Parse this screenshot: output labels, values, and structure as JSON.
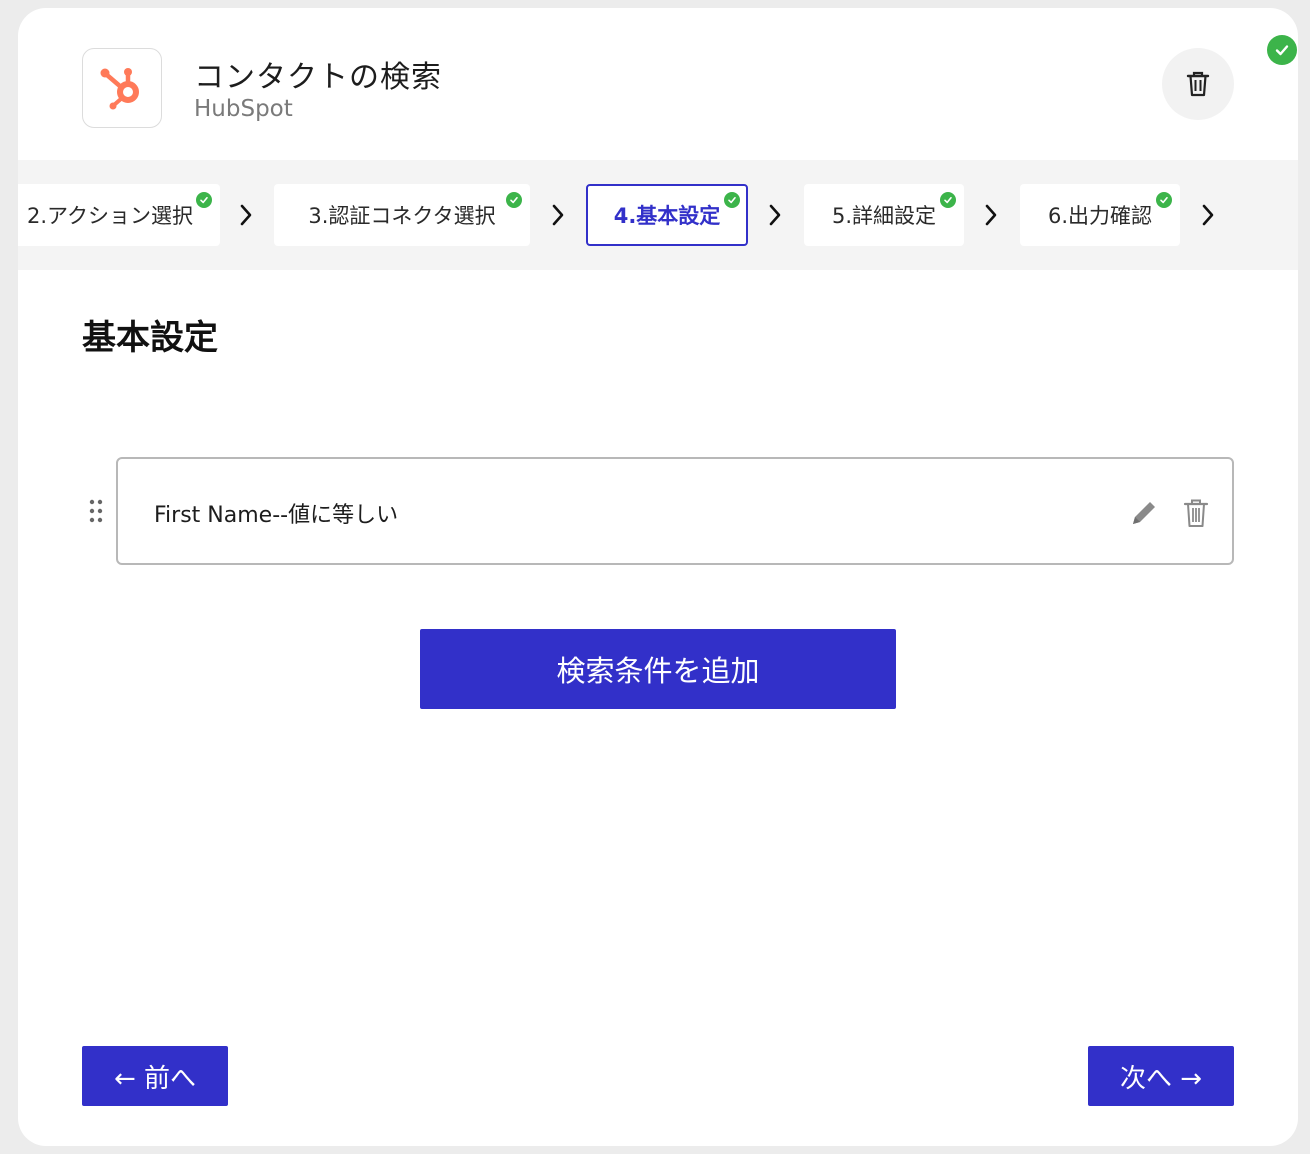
{
  "header": {
    "title": "コンタクトの検索",
    "app_name": "HubSpot",
    "logo_icon": "hubspot-sprocket-icon",
    "trash_icon": "trash-icon",
    "complete_icon": "check-circle-icon"
  },
  "steps": [
    {
      "label": "2.アクション選択",
      "completed": true,
      "active": false
    },
    {
      "label": "3.認証コネクタ選択",
      "completed": true,
      "active": false
    },
    {
      "label": "4.基本設定",
      "completed": true,
      "active": true
    },
    {
      "label": "5.詳細設定",
      "completed": true,
      "active": false
    },
    {
      "label": "6.出力確認",
      "completed": true,
      "active": false
    }
  ],
  "section": {
    "title": "基本設定"
  },
  "conditions": [
    {
      "text": "First Name--値に等しい"
    }
  ],
  "buttons": {
    "add_condition": "検索条件を追加",
    "prev": "← 前へ",
    "next": "次へ →"
  },
  "colors": {
    "accent": "#3230c9",
    "success": "#3cb44a",
    "hubspot": "#ff7a59"
  }
}
